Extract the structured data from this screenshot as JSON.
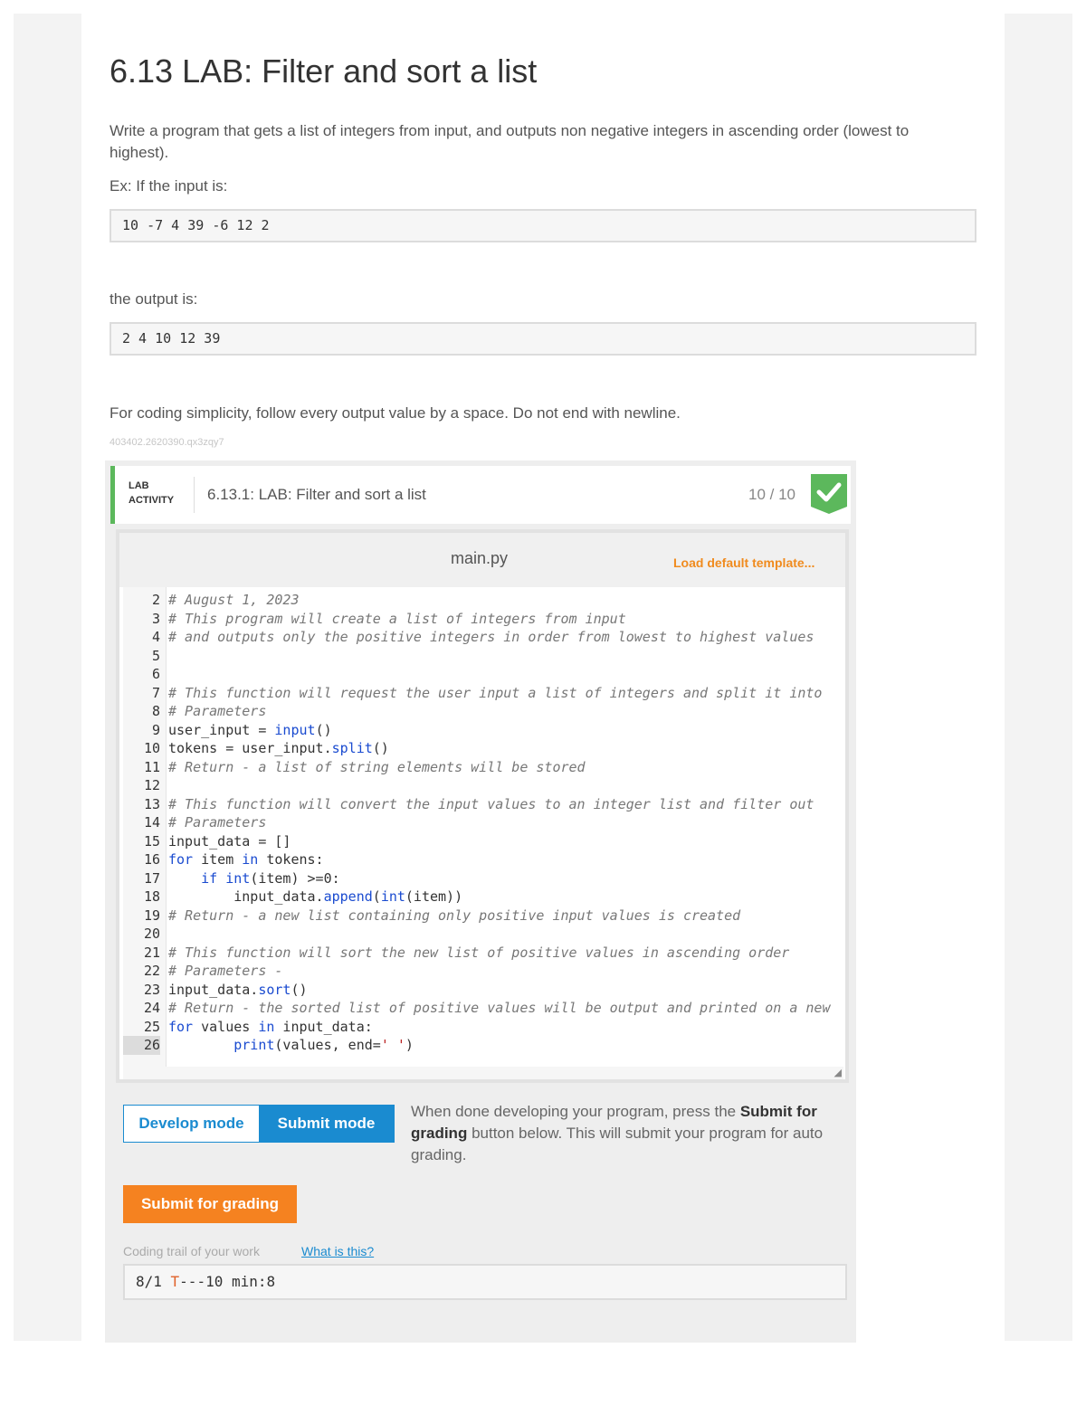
{
  "page": {
    "title": "6.13 LAB: Filter and sort a list",
    "description": "Write a program that gets a list of integers from input, and outputs non negative integers in ascending order (lowest to highest).",
    "example_intro": "Ex: If the input is:",
    "example_input": "10 -7 4 39 -6 12 2",
    "output_intro": "the output is:",
    "example_output": "2 4 10 12 39",
    "simplicity_note": "For coding simplicity, follow every output value by a space. Do not end with newline.",
    "small_id": "403402.2620390.qx3zqy7"
  },
  "lab": {
    "tag_line1": "LAB",
    "tag_line2": "ACTIVITY",
    "title": "6.13.1: LAB: Filter and sort a list",
    "score": "10 / 10",
    "status_color": "#5cb85c"
  },
  "editor": {
    "file_name": "main.py",
    "load_default": "Load default template...",
    "lines": [
      {
        "n": "2",
        "html": "<span class=\"c-com\"># August 1, 2023</span>"
      },
      {
        "n": "3",
        "html": "<span class=\"c-com\"># This program will create a list of integers from input</span>"
      },
      {
        "n": "4",
        "html": "<span class=\"c-com\"># and outputs only the positive integers in order from lowest to highest values</span>"
      },
      {
        "n": "5",
        "html": ""
      },
      {
        "n": "6",
        "html": ""
      },
      {
        "n": "7",
        "html": "<span class=\"c-com\"># This function will request the user input a list of integers and split it into</span>"
      },
      {
        "n": "8",
        "html": "<span class=\"c-com\"># Parameters</span>"
      },
      {
        "n": "9",
        "html": "user_input = <span class=\"c-fn\">input</span>()"
      },
      {
        "n": "10",
        "html": "tokens = user_input.<span class=\"c-fn\">split</span>()"
      },
      {
        "n": "11",
        "html": "<span class=\"c-com\"># Return - a list of string elements will be stored</span>"
      },
      {
        "n": "12",
        "html": ""
      },
      {
        "n": "13",
        "html": "<span class=\"c-com\"># This function will convert the input values to an integer list and filter out</span>"
      },
      {
        "n": "14",
        "html": "<span class=\"c-com\"># Parameters</span>"
      },
      {
        "n": "15",
        "html": "input_data = []"
      },
      {
        "n": "16",
        "html": "<span class=\"c-kw\">for</span> item <span class=\"c-kw\">in</span> tokens:"
      },
      {
        "n": "17",
        "html": "    <span class=\"c-kw\">if</span> <span class=\"c-fn\">int</span>(item) &gt;=0:"
      },
      {
        "n": "18",
        "html": "        input_data.<span class=\"c-fn\">append</span>(<span class=\"c-fn\">int</span>(item))"
      },
      {
        "n": "19",
        "html": "<span class=\"c-com\"># Return - a new list containing only positive input values is created</span>"
      },
      {
        "n": "20",
        "html": ""
      },
      {
        "n": "21",
        "html": "<span class=\"c-com\"># This function will sort the new list of positive values in ascending order</span>"
      },
      {
        "n": "22",
        "html": "<span class=\"c-com\"># Parameters -</span>"
      },
      {
        "n": "23",
        "html": "input_data.<span class=\"c-fn\">sort</span>()"
      },
      {
        "n": "24",
        "html": "<span class=\"c-com\"># Return - the sorted list of positive values will be output and printed on a new</span>"
      },
      {
        "n": "25",
        "html": "<span class=\"c-kw\">for</span> values <span class=\"c-kw\">in</span> input_data:"
      },
      {
        "n": "26",
        "html": "        <span class=\"c-fn\">print</span>(values, end=<span class=\"c-str\">' '</span>)",
        "active": true
      }
    ]
  },
  "modes": {
    "develop": "Develop mode",
    "submit": "Submit mode",
    "info_pre": "When done developing your program, press the ",
    "info_bold": "Submit for grading",
    "info_post": " button below. This will submit your program for auto grading."
  },
  "submit_button": "Submit for grading",
  "trail": {
    "label": "Coding trail of your work",
    "link": "What is this?",
    "prefix": "8/1 ",
    "t": "T",
    "rest": "---10 min:8"
  },
  "colors": {
    "accent_blue": "#1a8bd0",
    "accent_orange": "#f58220",
    "success_green": "#5cb85c"
  }
}
